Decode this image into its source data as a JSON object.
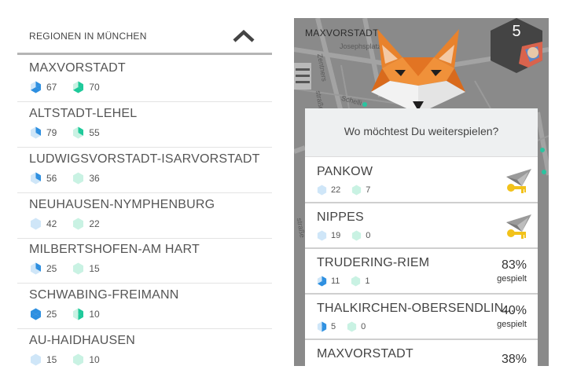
{
  "colors": {
    "blue_hex_light": "#cfe6f8",
    "blue_hex_full": "#2d8fe0",
    "teal_hex_light": "#c9f2e3",
    "teal_hex_full": "#1ec99a",
    "map_background": "#8a8a8a",
    "fox_orange": "#e8822c"
  },
  "left_panel": {
    "title": "REGIONEN IN MÜNCHEN",
    "collapse_icon": "chevron-up-icon",
    "regions": [
      {
        "name": "MAXVORSTADT",
        "blue_value": "67",
        "blue_progress": 0.67,
        "teal_value": "70",
        "teal_progress": 0.7
      },
      {
        "name": "ALTSTADT-LEHEL",
        "blue_value": "79",
        "blue_progress": 0.33,
        "teal_value": "55",
        "teal_progress": 0.33
      },
      {
        "name": "LUDWIGSVORSTADT-ISARVORSTADT",
        "blue_value": "56",
        "blue_progress": 0.33,
        "teal_value": "36",
        "teal_progress": 0
      },
      {
        "name": "NEUHAUSEN-NYMPHENBURG",
        "blue_value": "42",
        "blue_progress": 0,
        "teal_value": "22",
        "teal_progress": 0
      },
      {
        "name": "MILBERTSHOFEN-AM HART",
        "blue_value": "25",
        "blue_progress": 0.33,
        "teal_value": "15",
        "teal_progress": 0
      },
      {
        "name": "SCHWABING-FREIMANN",
        "blue_value": "25",
        "blue_progress": 1,
        "teal_value": "10",
        "teal_progress": 0.5
      },
      {
        "name": "AU-HAIDHAUSEN",
        "blue_value": "15",
        "blue_progress": 0,
        "teal_value": "10",
        "teal_progress": 0
      }
    ]
  },
  "app_screen": {
    "map_city": "MAXVORSTADT",
    "map_labels": [
      "Josephsplatz",
      "Zentners",
      "Schelli",
      "straße",
      "straße"
    ],
    "level_number": "5",
    "menu_icon": "hamburger-icon",
    "mascot_icon": "fox-icon",
    "dialog": {
      "question": "Wo möchtest Du weiterspielen?",
      "options": [
        {
          "name": "PANKOW",
          "blue_value": "22",
          "blue_progress": 0,
          "teal_value": "7",
          "teal_progress": 0,
          "icon": "locked-plane-icon"
        },
        {
          "name": "NIPPES",
          "blue_value": "19",
          "blue_progress": 0,
          "teal_value": "0",
          "teal_progress": 0,
          "icon": "locked-plane-icon"
        },
        {
          "name": "TRUDERING-RIEM",
          "blue_value": "11",
          "blue_progress": 0.66,
          "teal_value": "1",
          "teal_progress": 0,
          "percent": "83%",
          "percent_label": "gespielt"
        },
        {
          "name": "THALKIRCHEN-OBERSENDLIN...",
          "blue_value": "5",
          "blue_progress": 0.5,
          "teal_value": "0",
          "teal_progress": 0,
          "percent": "40%",
          "percent_label": "gespielt"
        },
        {
          "name": "MAXVORSTADT",
          "percent": "38%"
        }
      ]
    }
  }
}
